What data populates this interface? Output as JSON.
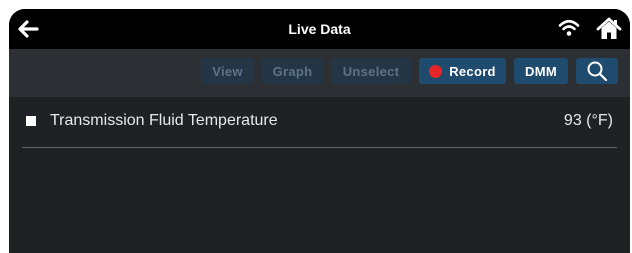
{
  "header": {
    "title": "Live Data",
    "back_icon": "back-arrow-icon",
    "wifi_icon": "wifi-icon",
    "home_icon": "home-icon"
  },
  "toolbar": {
    "view_label": "View",
    "graph_label": "Graph",
    "unselect_label": "Unselect",
    "record_label": "Record",
    "dmm_label": "DMM",
    "search_icon": "search-icon"
  },
  "rows": [
    {
      "label": "Transmission Fluid Temperature",
      "value": "93 (°F)",
      "checked": false
    }
  ],
  "colors": {
    "titlebar_bg": "#000000",
    "toolbar_bg": "#2c2f33",
    "content_bg": "#202124",
    "button_disabled_bg": "#243646",
    "button_disabled_text": "#5f7282",
    "button_active_bg": "#1f4b6e",
    "record_dot": "#e5252a"
  }
}
